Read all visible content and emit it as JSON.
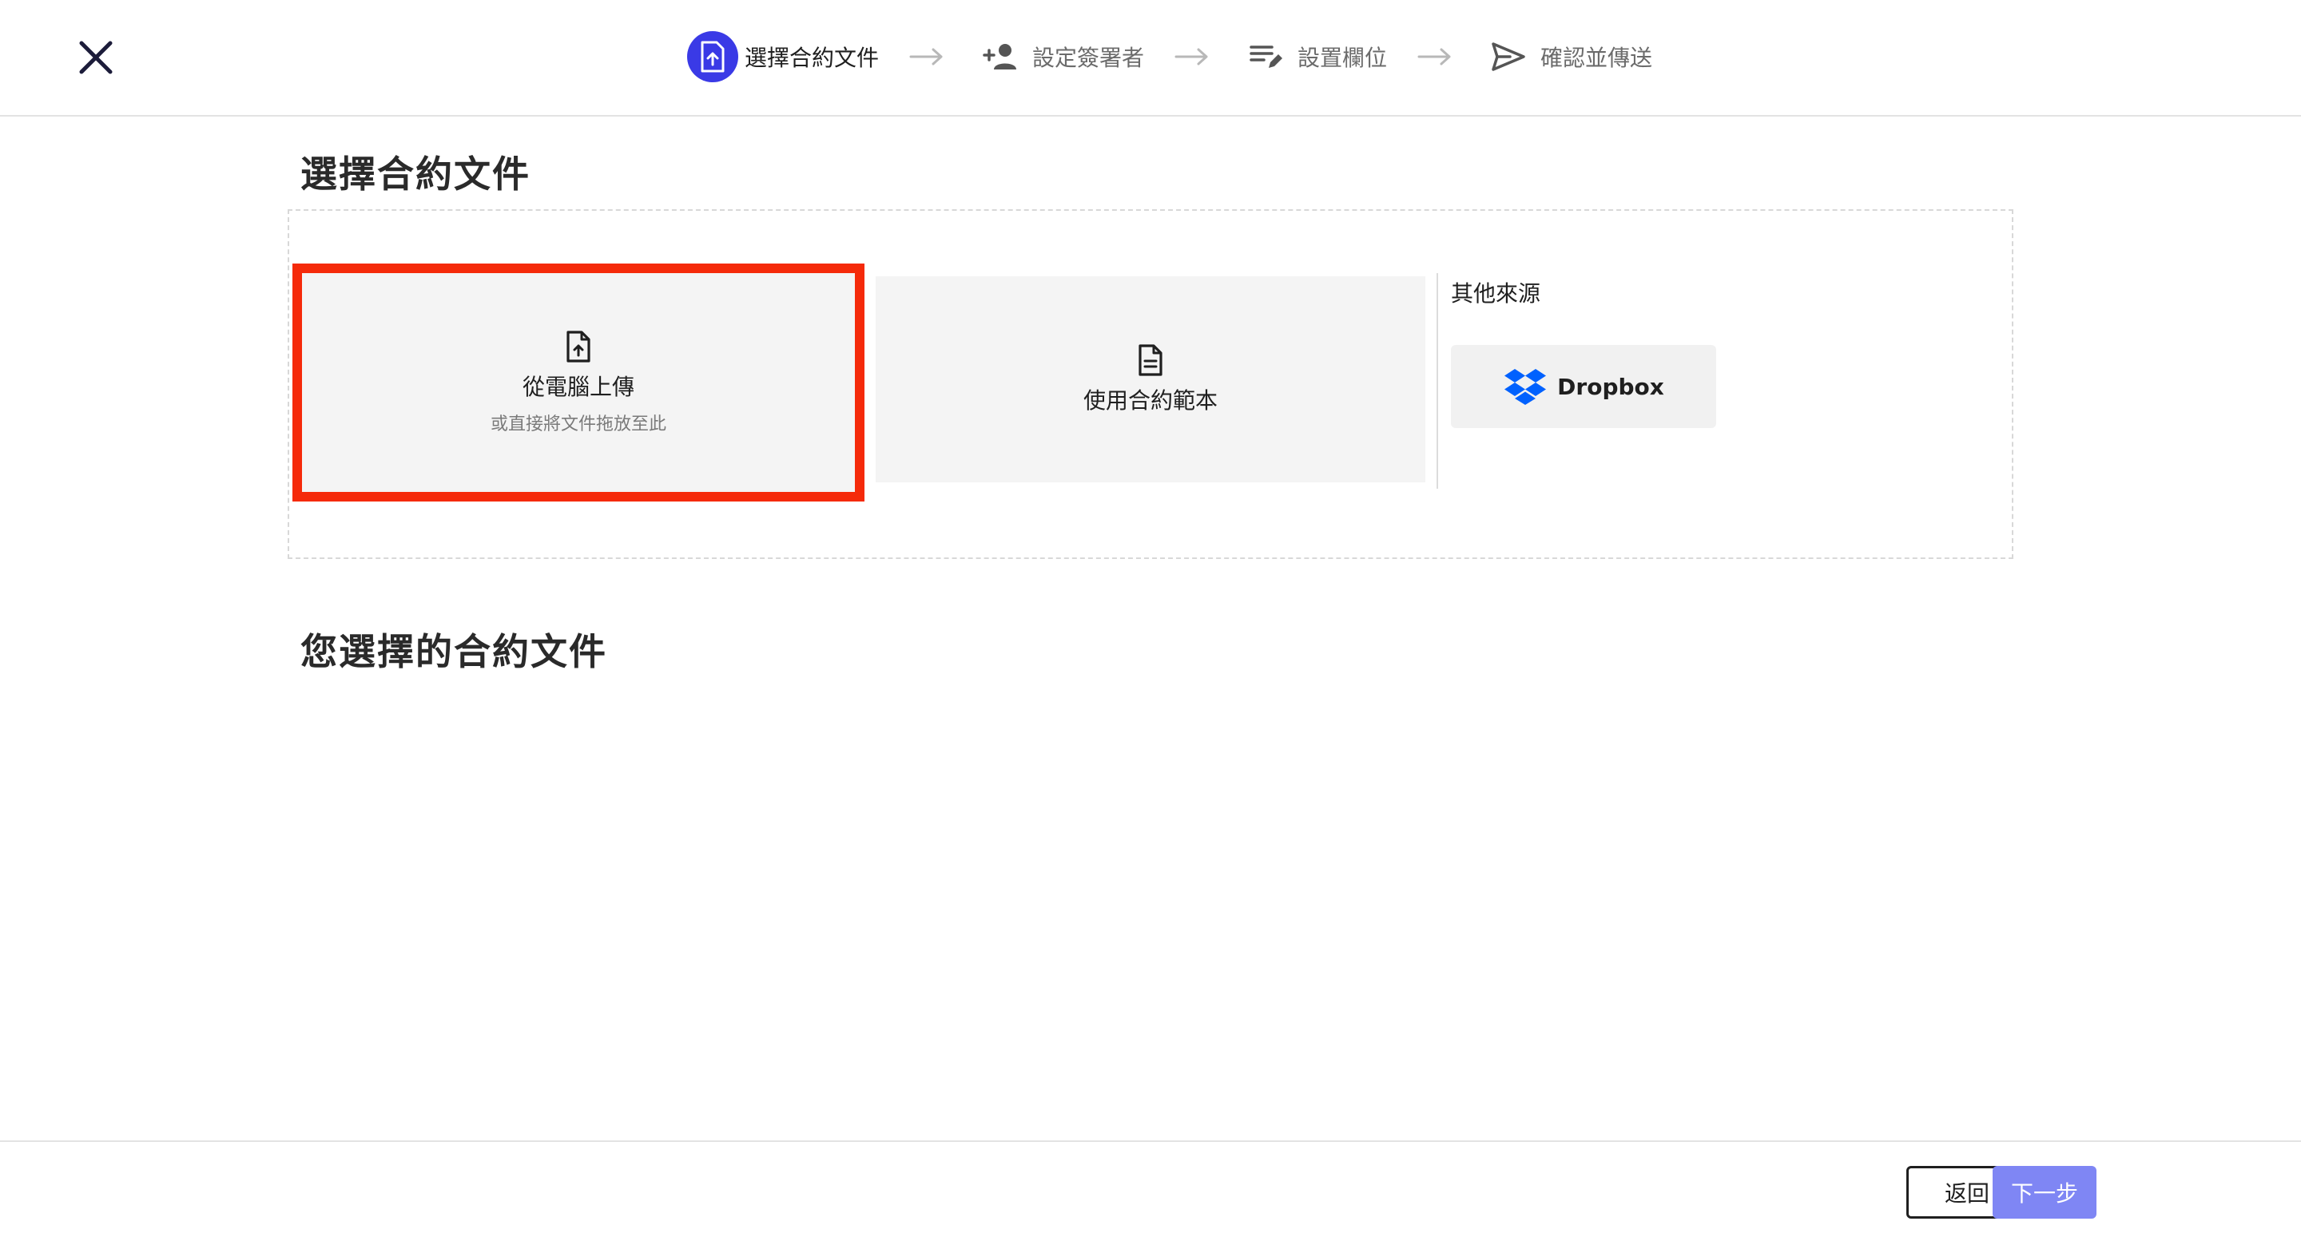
{
  "header": {
    "steps": [
      {
        "label": "選擇合約文件",
        "icon": "file-upload-icon",
        "active": true
      },
      {
        "label": "設定簽署者",
        "icon": "person-add-icon",
        "active": false
      },
      {
        "label": "設置欄位",
        "icon": "edit-list-icon",
        "active": false
      },
      {
        "label": "確認並傳送",
        "icon": "send-icon",
        "active": false
      }
    ]
  },
  "main": {
    "choose_title": "選擇合約文件",
    "upload_card": {
      "title": "從電腦上傳",
      "subtitle": "或直接將文件拖放至此"
    },
    "template_card": {
      "title": "使用合約範本"
    },
    "other_sources_label": "其他來源",
    "dropbox_label": "Dropbox",
    "selected_title": "您選擇的合約文件"
  },
  "footer": {
    "back_label": "返回",
    "next_label": "下一步"
  },
  "colors": {
    "accent": "#3a3ae6",
    "highlight": "#f52a0a",
    "next_button": "#7f86f4",
    "dropbox_blue": "#0061fe"
  }
}
